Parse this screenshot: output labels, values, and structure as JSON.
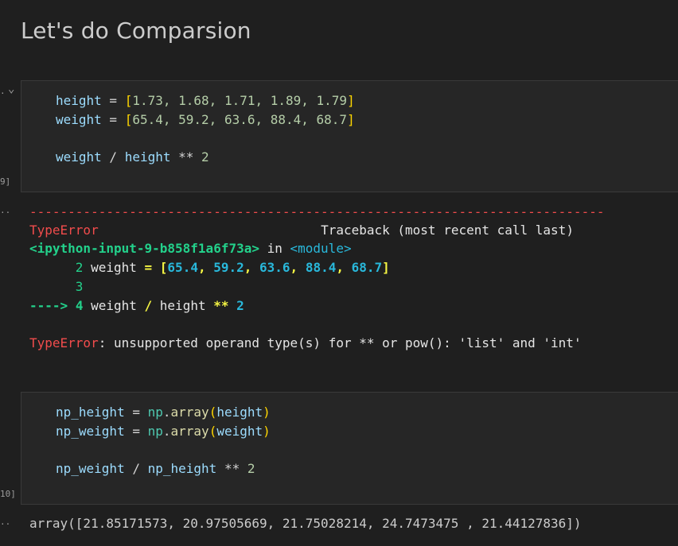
{
  "markdown": {
    "heading": "Let's do Comparsion"
  },
  "cell1": {
    "collapse_marker": ".",
    "collapse_chevron": "⌄",
    "exec_count_label": "9]",
    "lines": {
      "l1": {
        "var": "height",
        "eq": " = ",
        "ob": "[",
        "nums": "1.73, 1.68, 1.71, 1.89, 1.79",
        "cb": "]"
      },
      "l2": {
        "var": "weight",
        "eq": " = ",
        "ob": "[",
        "nums": "65.4, 59.2, 63.6, 88.4, 68.7",
        "cb": "]"
      },
      "l3": {
        "a": "weight",
        "op1": " / ",
        "b": "height",
        "op2": " ** ",
        "n": "2"
      }
    },
    "output_marker": "..",
    "error": {
      "rule": "---------------------------------------------------------------------------",
      "type": "TypeError",
      "spacer": "                             ",
      "traceback_label": "Traceback (most recent call last)",
      "input_ref": "<ipython-input-9-b858f1a6f73a>",
      "in_text": " in ",
      "module_ref": "<module>",
      "tb_line2": {
        "indent": "      ",
        "lineno": "2",
        "code_a": " weight ",
        "eq": "=",
        "sp": " ",
        "ob": "[",
        "v1": "65.4",
        "c1": ", ",
        "v2": "59.2",
        "c2": ", ",
        "v3": "63.6",
        "c3": ", ",
        "v4": "88.4",
        "c4": ", ",
        "v5": "68.7",
        "cb": "]"
      },
      "tb_line3": {
        "indent": "      ",
        "lineno": "3"
      },
      "tb_line4": {
        "arrow": "---->",
        "sp": " ",
        "lineno": "4",
        "code_a": " weight ",
        "slash": "/",
        "code_b": " height ",
        "pow": "**",
        "sp2": " ",
        "n": "2"
      },
      "message_type": "TypeError",
      "message_text": ": unsupported operand type(s) for ** or pow(): 'list' and 'int'"
    }
  },
  "cell2": {
    "exec_count_label": "10]",
    "lines": {
      "l1": {
        "var": "np_height",
        "eq": " = ",
        "mod": "np",
        "dot": ".",
        "fn": "array",
        "op": "(",
        "arg": "height",
        "cp": ")"
      },
      "l2": {
        "var": "np_weight",
        "eq": " = ",
        "mod": "np",
        "dot": ".",
        "fn": "array",
        "op": "(",
        "arg": "weight",
        "cp": ")"
      },
      "l3": {
        "a": "np_weight",
        "op1": " / ",
        "b": "np_height",
        "op2": " ** ",
        "n": "2"
      }
    },
    "output_marker": "..",
    "output": "array([21.85171573, 20.97505669, 21.75028214, 24.7473475 , 21.44127836])"
  }
}
